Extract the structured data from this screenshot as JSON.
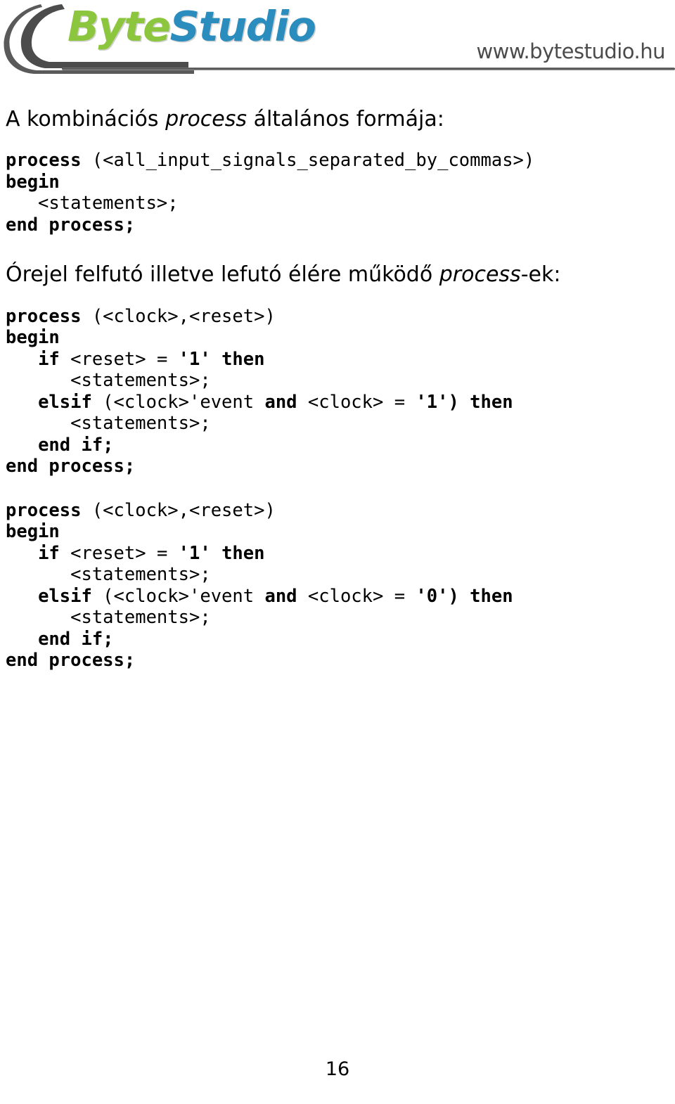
{
  "header": {
    "logo": {
      "part_green": "Byte",
      "part_blue": "Studio",
      "color_green": "#8cc63e",
      "color_blue": "#2b8cbe",
      "swoosh_color": "#4c4c4c"
    },
    "url": "www.bytestudio.hu"
  },
  "content": {
    "heading_1": {
      "before": "A kombinációs ",
      "italic": "process",
      "after": " általános formája:"
    },
    "code_block_1": [
      [
        {
          "text": "process",
          "bold": true
        },
        {
          "text": " (<all_input_signals_separated_by_commas>)",
          "bold": false
        }
      ],
      [
        {
          "text": "begin",
          "bold": true
        }
      ],
      [
        {
          "text": "   <statements>;",
          "bold": false
        }
      ],
      [
        {
          "text": "end process;",
          "bold": true
        }
      ]
    ],
    "heading_2": {
      "before": "Órejel felfutó illetve lefutó élére működő ",
      "italic": "process",
      "after": "-ek:"
    },
    "code_block_2": [
      [
        {
          "text": "process",
          "bold": true
        },
        {
          "text": " (<clock>,<reset>)",
          "bold": false
        }
      ],
      [
        {
          "text": "begin",
          "bold": true
        }
      ],
      [
        {
          "text": "   ",
          "bold": false
        },
        {
          "text": "if",
          "bold": true
        },
        {
          "text": " <reset> = ",
          "bold": false
        },
        {
          "text": "'1' then",
          "bold": true
        }
      ],
      [
        {
          "text": "      <statements>;",
          "bold": false
        }
      ],
      [
        {
          "text": "   ",
          "bold": false
        },
        {
          "text": "elsif",
          "bold": true
        },
        {
          "text": " (<clock>'event ",
          "bold": false
        },
        {
          "text": "and",
          "bold": true
        },
        {
          "text": " <clock> = ",
          "bold": false
        },
        {
          "text": "'1') then",
          "bold": true
        }
      ],
      [
        {
          "text": "      <statements>;",
          "bold": false
        }
      ],
      [
        {
          "text": "   ",
          "bold": false
        },
        {
          "text": "end if;",
          "bold": true
        }
      ],
      [
        {
          "text": "end process;",
          "bold": true
        }
      ]
    ],
    "code_block_3": [
      [
        {
          "text": "process",
          "bold": true
        },
        {
          "text": " (<clock>,<reset>)",
          "bold": false
        }
      ],
      [
        {
          "text": "begin",
          "bold": true
        }
      ],
      [
        {
          "text": "   ",
          "bold": false
        },
        {
          "text": "if",
          "bold": true
        },
        {
          "text": " <reset> = ",
          "bold": false
        },
        {
          "text": "'1' then",
          "bold": true
        }
      ],
      [
        {
          "text": "      <statements>;",
          "bold": false
        }
      ],
      [
        {
          "text": "   ",
          "bold": false
        },
        {
          "text": "elsif",
          "bold": true
        },
        {
          "text": " (<clock>'event ",
          "bold": false
        },
        {
          "text": "and",
          "bold": true
        },
        {
          "text": " <clock> = ",
          "bold": false
        },
        {
          "text": "'0') then",
          "bold": true
        }
      ],
      [
        {
          "text": "      <statements>;",
          "bold": false
        }
      ],
      [
        {
          "text": "   ",
          "bold": false
        },
        {
          "text": "end if;",
          "bold": true
        }
      ],
      [
        {
          "text": "end process;",
          "bold": true
        }
      ]
    ]
  },
  "footer": {
    "page_number": "16"
  }
}
